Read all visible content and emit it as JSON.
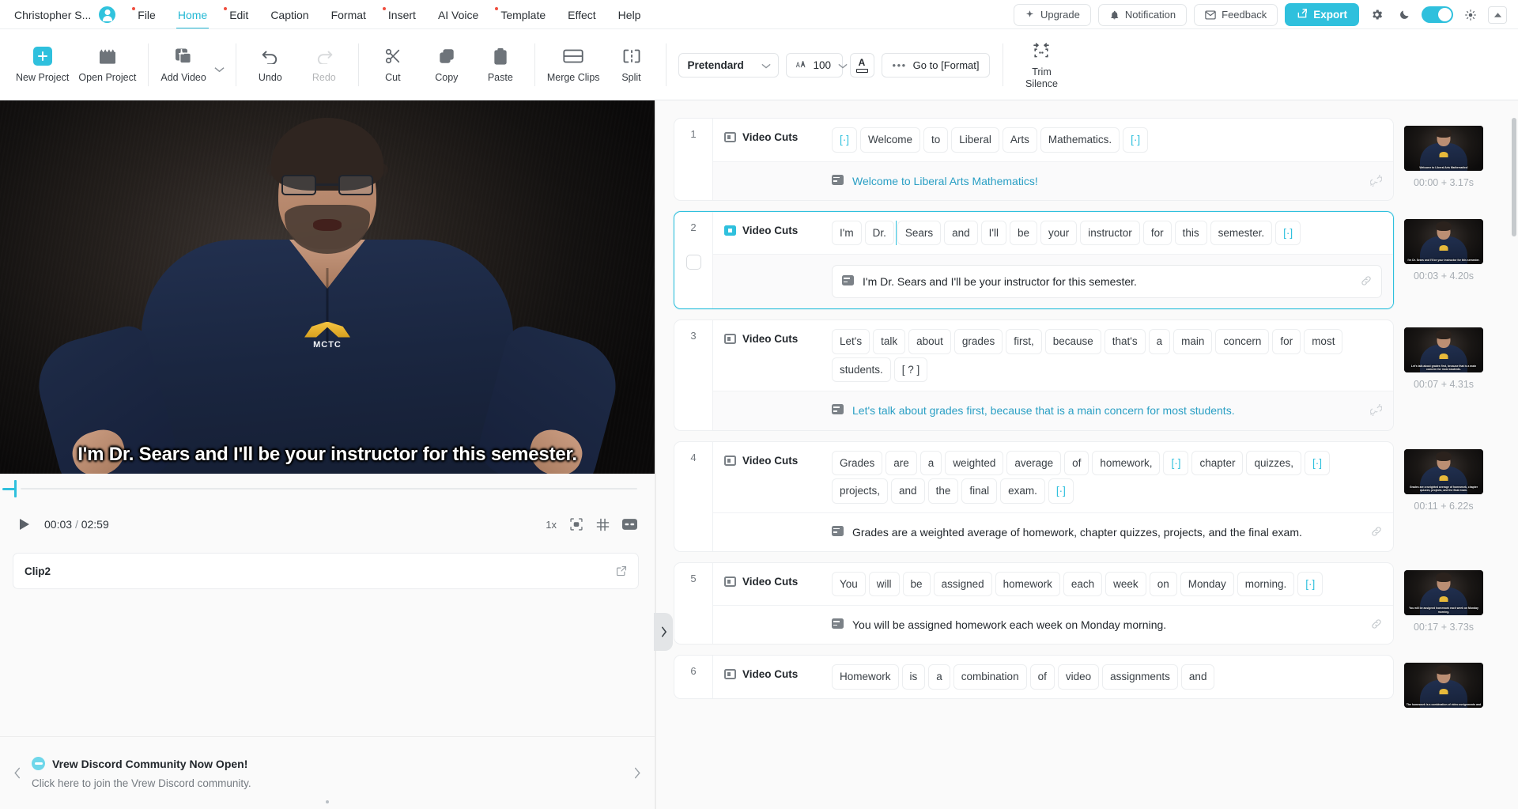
{
  "menubar": {
    "profile_name": "Christopher S...",
    "avatar_icon": "user-avatar-icon",
    "items": [
      {
        "label": "File",
        "active": false,
        "badge": true
      },
      {
        "label": "Home",
        "active": true,
        "badge": false
      },
      {
        "label": "Edit",
        "active": false,
        "badge": true
      },
      {
        "label": "Caption",
        "active": false,
        "badge": false
      },
      {
        "label": "Format",
        "active": false,
        "badge": false
      },
      {
        "label": "Insert",
        "active": false,
        "badge": true
      },
      {
        "label": "AI Voice",
        "active": false,
        "badge": false
      },
      {
        "label": "Template",
        "active": false,
        "badge": true
      },
      {
        "label": "Effect",
        "active": false,
        "badge": false
      },
      {
        "label": "Help",
        "active": false,
        "badge": false
      }
    ],
    "upgrade_label": "Upgrade",
    "notification_label": "Notification",
    "feedback_label": "Feedback",
    "export_label": "Export",
    "accent_color": "#2fc0dd",
    "badge_color": "#f04e3e"
  },
  "toolbar": {
    "new_project": "New Project",
    "open_project": "Open Project",
    "add_video": "Add Video",
    "undo": "Undo",
    "redo": "Redo",
    "cut": "Cut",
    "copy": "Copy",
    "paste": "Paste",
    "merge_clips": "Merge Clips",
    "split": "Split",
    "font_family_value": "Pretendard",
    "font_size_value": "100",
    "goto_format": "Go to [Format]",
    "trim_silence_line1": "Trim",
    "trim_silence_line2": "Silence"
  },
  "player": {
    "caption_text": "I'm Dr. Sears and I'll be your instructor for this semester.",
    "current_time": "00:03",
    "separator": "/",
    "total_time": "02:59",
    "speed": "1x",
    "clip_name": "Clip2"
  },
  "promo": {
    "title": "Vrew Discord Community Now Open!",
    "subtitle": "Click here to join the Vrew Discord community."
  },
  "clips": [
    {
      "index": "1",
      "cut_label": "Video Cuts",
      "selected": false,
      "words": [
        {
          "t": "[·]",
          "token": true
        },
        {
          "t": "Welcome"
        },
        {
          "t": "to"
        },
        {
          "t": "Liberal"
        },
        {
          "t": "Arts"
        },
        {
          "t": "Mathematics."
        },
        {
          "t": "[·]",
          "token": true
        }
      ],
      "subtitle": "Welcome to Liberal Arts Mathematics!",
      "subtitle_style": "link",
      "subtitle_boxed": false,
      "link_state": "broken",
      "thumb_time": "00:00 + 3.17s",
      "thumb_caption": "Welcome to Liberal Arts Mathematics!"
    },
    {
      "index": "2",
      "cut_label": "Video Cuts",
      "selected": true,
      "words": [
        {
          "t": "I'm"
        },
        {
          "t": "Dr."
        },
        {
          "t": "Sears",
          "cursor": true
        },
        {
          "t": "and"
        },
        {
          "t": "I'll"
        },
        {
          "t": "be"
        },
        {
          "t": "your"
        },
        {
          "t": "instructor"
        },
        {
          "t": "for"
        },
        {
          "t": "this"
        },
        {
          "t": "semester."
        },
        {
          "t": "[·]",
          "token": true
        }
      ],
      "subtitle": "I'm Dr. Sears and I'll be your instructor for this semester.",
      "subtitle_style": "plain",
      "subtitle_boxed": true,
      "link_state": "linked",
      "thumb_time": "00:03 + 4.20s",
      "thumb_caption": "I'm Dr. Sears and I'll be your instructor for this semester."
    },
    {
      "index": "3",
      "cut_label": "Video Cuts",
      "selected": false,
      "words": [
        {
          "t": "Let's"
        },
        {
          "t": "talk"
        },
        {
          "t": "about"
        },
        {
          "t": "grades"
        },
        {
          "t": "first,"
        },
        {
          "t": "because"
        },
        {
          "t": "that's"
        },
        {
          "t": "a"
        },
        {
          "t": "main"
        },
        {
          "t": "concern"
        },
        {
          "t": "for"
        },
        {
          "t": "most"
        },
        {
          "t": "students."
        },
        {
          "t": "[ ? ]"
        }
      ],
      "subtitle": "Let's talk about grades first, because that is a main concern for most students.",
      "subtitle_style": "link",
      "subtitle_boxed": false,
      "link_state": "broken",
      "thumb_time": "00:07 + 4.31s",
      "thumb_caption": "Let's talk about grades first, because that is a main concern for most students."
    },
    {
      "index": "4",
      "cut_label": "Video Cuts",
      "selected": false,
      "words": [
        {
          "t": "Grades"
        },
        {
          "t": "are"
        },
        {
          "t": "a"
        },
        {
          "t": "weighted"
        },
        {
          "t": "average"
        },
        {
          "t": "of"
        },
        {
          "t": "homework,"
        },
        {
          "t": "[·]",
          "token": true
        },
        {
          "t": "chapter"
        },
        {
          "t": "quizzes,"
        },
        {
          "t": "[·]",
          "token": true
        },
        {
          "t": "projects,"
        },
        {
          "t": "and"
        },
        {
          "t": "the"
        },
        {
          "t": "final"
        },
        {
          "t": "exam."
        },
        {
          "t": "[·]",
          "token": true
        }
      ],
      "subtitle": "Grades are a weighted average of homework, chapter quizzes, projects, and the final exam.",
      "subtitle_style": "plain",
      "subtitle_boxed": false,
      "link_state": "linked",
      "thumb_time": "00:11 + 6.22s",
      "thumb_caption": "Grades are a weighted average of homework, chapter quizzes, projects, and the final exam."
    },
    {
      "index": "5",
      "cut_label": "Video Cuts",
      "selected": false,
      "words": [
        {
          "t": "You"
        },
        {
          "t": "will"
        },
        {
          "t": "be"
        },
        {
          "t": "assigned"
        },
        {
          "t": "homework"
        },
        {
          "t": "each"
        },
        {
          "t": "week"
        },
        {
          "t": "on"
        },
        {
          "t": "Monday"
        },
        {
          "t": "morning."
        },
        {
          "t": "[·]",
          "token": true
        }
      ],
      "subtitle": "You will be assigned homework each week on Monday morning.",
      "subtitle_style": "plain",
      "subtitle_boxed": false,
      "link_state": "linked",
      "thumb_time": "00:17 + 3.73s",
      "thumb_caption": "You will be assigned homework each week on Monday morning."
    },
    {
      "index": "6",
      "cut_label": "Video Cuts",
      "selected": false,
      "words": [
        {
          "t": "Homework"
        },
        {
          "t": "is"
        },
        {
          "t": "a"
        },
        {
          "t": "combination"
        },
        {
          "t": "of"
        },
        {
          "t": "video"
        },
        {
          "t": "assignments"
        },
        {
          "t": "and"
        }
      ],
      "subtitle": "",
      "subtitle_style": "plain",
      "subtitle_boxed": false,
      "link_state": "none",
      "thumb_time": "",
      "thumb_caption": "The homework is a combination of video assignments and"
    }
  ]
}
